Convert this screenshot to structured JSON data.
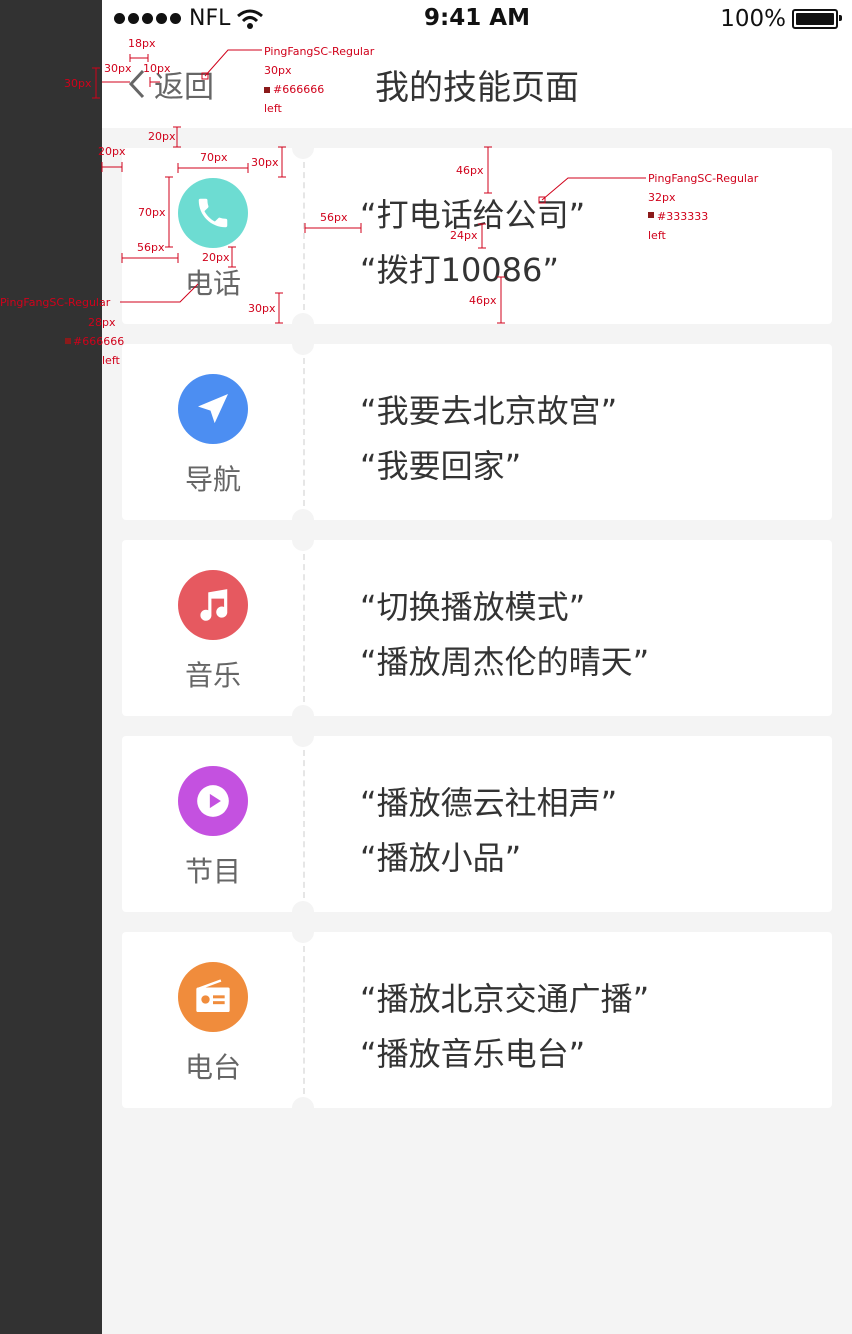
{
  "status_bar": {
    "carrier": "NFL",
    "time": "9:41 AM",
    "battery": "100%"
  },
  "nav": {
    "back_label": "返回",
    "title": "我的技能页面"
  },
  "skills": [
    {
      "label": "电话",
      "icon": "phone-icon",
      "color": "#6ddcd2",
      "phrases": [
        "“打电话给公司”",
        "“拨打10086”"
      ]
    },
    {
      "label": "导航",
      "icon": "navigation-arrow-icon",
      "color": "#4c8ef2",
      "phrases": [
        "“我要去北京故宫”",
        "“我要回家”"
      ]
    },
    {
      "label": "音乐",
      "icon": "music-note-icon",
      "color": "#e65960",
      "phrases": [
        "“切换播放模式”",
        "“播放周杰伦的晴天”"
      ]
    },
    {
      "label": "节目",
      "icon": "play-icon",
      "color": "#c451e0",
      "phrases": [
        "“播放德云社相声”",
        "“播放小品”"
      ]
    },
    {
      "label": "电台",
      "icon": "radio-icon",
      "color": "#f08c3c",
      "phrases": [
        "“播放北京交通广播”",
        "“播放音乐电台”"
      ]
    }
  ],
  "annotations": {
    "m18": "18px",
    "m30a": "30px",
    "m10": "10px",
    "m30b": "30px",
    "nav_font": "PingFangSC-Regular",
    "nav_size": "30px",
    "nav_color": "#666666",
    "nav_align": "left",
    "m20a": "20px",
    "m20b": "20px",
    "m70a": "70px",
    "m30c": "30px",
    "m70b": "70px",
    "m56a": "56px",
    "m20c": "20px",
    "m56b": "56px",
    "m30d": "30px",
    "m46a": "46px",
    "m24": "24px",
    "m46b": "46px",
    "phrase_font": "PingFangSC-Regular",
    "phrase_size": "32px",
    "phrase_color": "#333333",
    "phrase_align": "left",
    "cat_font": "PingFangSC-Regular",
    "cat_size": "28px",
    "cat_color": "#666666",
    "cat_align": "left"
  }
}
